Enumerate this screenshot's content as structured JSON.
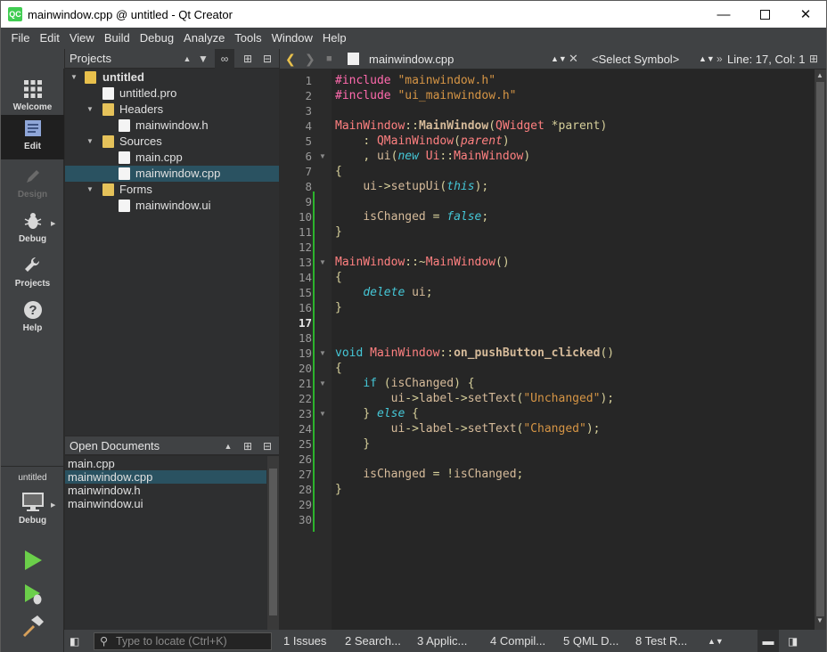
{
  "window": {
    "title": "mainwindow.cpp @ untitled - Qt Creator",
    "app_icon": "QC"
  },
  "menu": [
    "File",
    "Edit",
    "View",
    "Build",
    "Debug",
    "Analyze",
    "Tools",
    "Window",
    "Help"
  ],
  "modes": [
    {
      "label": "Welcome",
      "icon": "grid-icon"
    },
    {
      "label": "Edit",
      "icon": "document-icon"
    },
    {
      "label": "Design",
      "icon": "pencil-icon"
    },
    {
      "label": "Debug",
      "icon": "bug-icon"
    },
    {
      "label": "Projects",
      "icon": "wrench-icon"
    },
    {
      "label": "Help",
      "icon": "question-icon"
    }
  ],
  "active_mode": "Edit",
  "projects_pane": {
    "title": "Projects",
    "tree": [
      {
        "label": "untitled",
        "kind": "project"
      },
      {
        "label": "untitled.pro",
        "kind": "file"
      },
      {
        "label": "Headers",
        "kind": "folder"
      },
      {
        "label": "mainwindow.h",
        "kind": "file"
      },
      {
        "label": "Sources",
        "kind": "folder"
      },
      {
        "label": "main.cpp",
        "kind": "file"
      },
      {
        "label": "mainwindow.cpp",
        "kind": "file",
        "selected": true
      },
      {
        "label": "Forms",
        "kind": "folder"
      },
      {
        "label": "mainwindow.ui",
        "kind": "file"
      }
    ]
  },
  "open_documents": {
    "title": "Open Documents",
    "items": [
      "main.cpp",
      "mainwindow.cpp",
      "mainwindow.h",
      "mainwindow.ui"
    ],
    "selected": "mainwindow.cpp"
  },
  "kit": {
    "project": "untitled",
    "label": "Debug"
  },
  "editor": {
    "file": "mainwindow.cpp",
    "symbol": "<Select Symbol>",
    "position": "Line: 17, Col: 1",
    "current_line": 17,
    "lines": [
      {
        "n": "1",
        "c": "#include \"mainwindow.h\""
      },
      {
        "n": "2",
        "c": "#include \"ui_mainwindow.h\""
      },
      {
        "n": "3",
        "c": ""
      },
      {
        "n": "4",
        "c": "MainWindow::MainWindow(QWidget *parent)"
      },
      {
        "n": "5",
        "c": "    : QMainWindow(parent)"
      },
      {
        "n": "6",
        "c": "    , ui(new Ui::MainWindow)"
      },
      {
        "n": "7",
        "c": "{"
      },
      {
        "n": "8",
        "c": "    ui->setupUi(this);"
      },
      {
        "n": "9",
        "c": ""
      },
      {
        "n": "10",
        "c": "    isChanged = false;"
      },
      {
        "n": "11",
        "c": "}"
      },
      {
        "n": "12",
        "c": ""
      },
      {
        "n": "13",
        "c": "MainWindow::~MainWindow()"
      },
      {
        "n": "14",
        "c": "{"
      },
      {
        "n": "15",
        "c": "    delete ui;"
      },
      {
        "n": "16",
        "c": "}"
      },
      {
        "n": "17",
        "c": ""
      },
      {
        "n": "18",
        "c": ""
      },
      {
        "n": "19",
        "c": "void MainWindow::on_pushButton_clicked()"
      },
      {
        "n": "20",
        "c": "{"
      },
      {
        "n": "21",
        "c": "    if (isChanged) {"
      },
      {
        "n": "22",
        "c": "        ui->label->setText(\"Unchanged\");"
      },
      {
        "n": "23",
        "c": "    } else {"
      },
      {
        "n": "24",
        "c": "        ui->label->setText(\"Changed\");"
      },
      {
        "n": "25",
        "c": "    }"
      },
      {
        "n": "26",
        "c": ""
      },
      {
        "n": "27",
        "c": "    isChanged = !isChanged;"
      },
      {
        "n": "28",
        "c": "}"
      },
      {
        "n": "29",
        "c": ""
      },
      {
        "n": "30",
        "c": ""
      }
    ]
  },
  "statusbar": {
    "locator_placeholder": "Type to locate (Ctrl+K)",
    "panes": [
      "1  Issues",
      "2  Search...",
      "3  Applic...",
      "4  Compil...",
      "5  QML D...",
      "8  Test R..."
    ]
  }
}
